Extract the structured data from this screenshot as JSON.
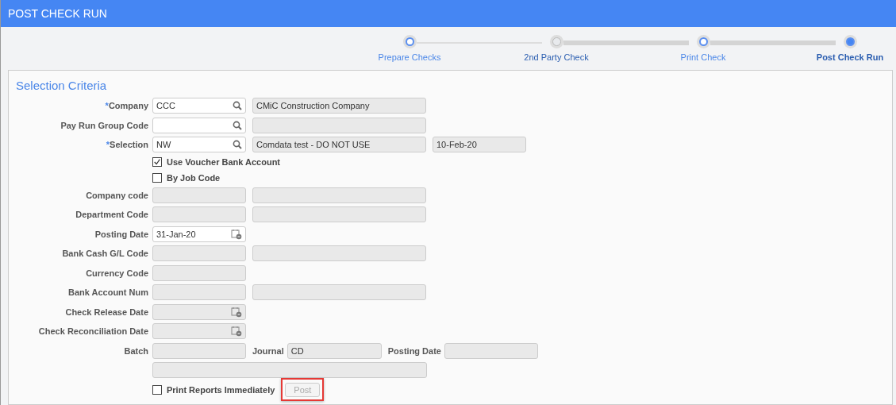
{
  "window": {
    "title": "POST CHECK RUN"
  },
  "steps": [
    {
      "label": "Prepare Checks",
      "visited": true,
      "selected": false
    },
    {
      "label": "2nd Party Check",
      "visited": false,
      "selected": false
    },
    {
      "label": "Print Check",
      "visited": true,
      "selected": false
    },
    {
      "label": "Post Check Run",
      "visited": true,
      "selected": true
    }
  ],
  "section": {
    "title": "Selection Criteria"
  },
  "rows": [
    {
      "kind": "fields",
      "marker": "*",
      "label": "Company",
      "fields": [
        {
          "kind": "lookup",
          "value": "CCC",
          "editable": true
        },
        {
          "value": "CMiC Construction Company",
          "editable": false
        }
      ]
    },
    {
      "kind": "fields",
      "label": "Pay Run Group Code",
      "fields": [
        {
          "kind": "lookup",
          "editable": true
        },
        {
          "editable": false
        }
      ]
    },
    {
      "kind": "fields",
      "marker": "*",
      "label": "Selection",
      "fields": [
        {
          "kind": "lookup",
          "value": "NW",
          "editable": true
        },
        {
          "value": "Comdata test - DO NOT USE",
          "editable": false
        },
        {
          "value": "10-Feb-20",
          "editable": false
        }
      ]
    },
    {
      "kind": "checkbox",
      "label": "Use Voucher Bank Account",
      "checked": true
    },
    {
      "kind": "checkbox",
      "label": "By Job Code",
      "checked": false
    },
    {
      "kind": "fields",
      "label": "Company code",
      "fields": [
        {
          "editable": false
        },
        {
          "editable": false
        }
      ]
    },
    {
      "kind": "fields",
      "label": "Department Code",
      "fields": [
        {
          "editable": false
        },
        {
          "editable": false
        }
      ]
    },
    {
      "kind": "fields",
      "label": "Posting Date",
      "fields": [
        {
          "kind": "date",
          "value": "31-Jan-20",
          "editable": true
        }
      ]
    },
    {
      "kind": "fields",
      "label": "Bank Cash G/L Code",
      "fields": [
        {
          "editable": false
        },
        {
          "editable": false
        }
      ]
    },
    {
      "kind": "fields",
      "label": "Currency Code",
      "fields": [
        {
          "editable": false
        }
      ]
    },
    {
      "kind": "fields",
      "label": "Bank Account Num",
      "fields": [
        {
          "editable": false
        },
        {
          "editable": false
        }
      ]
    },
    {
      "kind": "fields",
      "label": "Check Release Date",
      "fields": [
        {
          "kind": "date",
          "editable": false
        }
      ]
    },
    {
      "kind": "fields",
      "label": "Check Reconciliation Date",
      "fields": [
        {
          "kind": "date",
          "editable": false
        }
      ]
    },
    {
      "kind": "inline",
      "items": [
        {
          "label": "Batch",
          "field": {
            "editable": false
          }
        },
        {
          "label": "Journal",
          "field": {
            "value": "CD",
            "editable": false
          }
        },
        {
          "label": "Posting Date",
          "field": {
            "editable": false
          }
        }
      ]
    },
    {
      "kind": "wide",
      "field": {
        "editable": false
      }
    },
    {
      "kind": "action",
      "checkbox": {
        "label": "Print Reports Immediately",
        "checked": false
      },
      "button": {
        "label": "Post",
        "disabled": true,
        "highlighted": true
      }
    }
  ]
}
